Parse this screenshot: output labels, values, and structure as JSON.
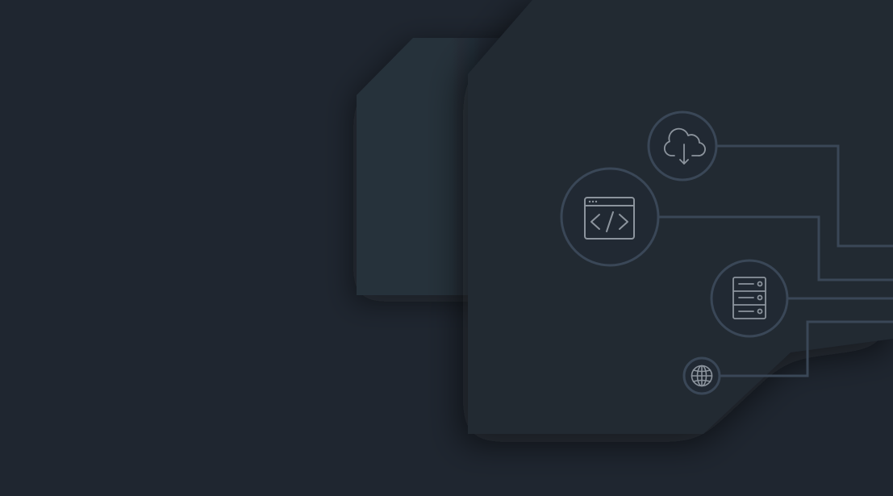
{
  "palette": {
    "background": "#1f2630",
    "panel_back": "#28313c",
    "panel_front": "#212933",
    "line": "#3a4757",
    "icon_stroke": "#8c949d"
  },
  "icons": [
    "cloud-download-icon",
    "code-window-icon",
    "server-rack-icon",
    "globe-icon"
  ]
}
